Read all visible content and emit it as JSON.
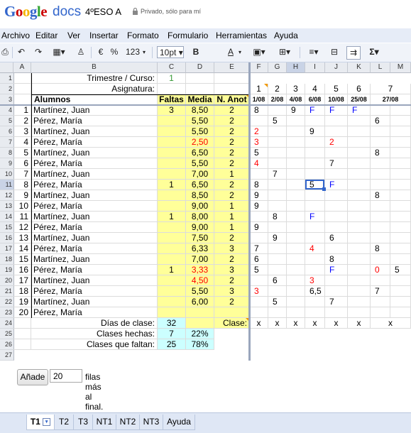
{
  "header": {
    "logo_text": "Google",
    "product": "docs",
    "doc_title": "4ºESO A",
    "privacy": "Privado, sólo para mí"
  },
  "menu": [
    "Archivo",
    "Editar",
    "Ver",
    "Insertar",
    "Formato",
    "Formulario",
    "Herramientas",
    "Ayuda"
  ],
  "toolbar": {
    "items": [
      "print-icon",
      "undo-icon",
      "redo-icon",
      "paint-format-icon",
      "clear-format-icon"
    ],
    "currency": "€",
    "percent": "%",
    "number_format": "123",
    "font_size": "10pt",
    "bold": "B",
    "text_color": "A",
    "sum": "Σ"
  },
  "columns": [
    "A",
    "B",
    "C",
    "D",
    "E",
    "F",
    "G",
    "H",
    "I",
    "J",
    "K",
    "L",
    "M"
  ],
  "selected_col": "H",
  "selected_row": 11,
  "sheet": {
    "r1": {
      "label": "Trimestre / Curso:",
      "value": "1"
    },
    "r2": {
      "label": "Asignatura:",
      "days": [
        "1",
        "2",
        "3",
        "4",
        "5",
        "6",
        "7"
      ]
    },
    "r3": {
      "alumnos": "Alumnos",
      "faltas": "Faltas",
      "media": "Media",
      "nanot": "N. Anot",
      "dates": [
        "1/08",
        "2/08",
        "4/08",
        "6/08",
        "10/08",
        "25/08",
        "27/08"
      ]
    },
    "students": [
      {
        "n": "1",
        "name": "Martínez, Juan",
        "faltas": "3",
        "media": "8,50",
        "anot": "2",
        "g": [
          "8",
          "",
          "9",
          "F",
          "F",
          "F",
          "",
          ""
        ]
      },
      {
        "n": "2",
        "name": "Pérez, María",
        "faltas": "",
        "media": "5,50",
        "anot": "2",
        "g": [
          "",
          "5",
          "",
          "",
          "",
          "",
          "6",
          ""
        ]
      },
      {
        "n": "3",
        "name": "Martínez, Juan",
        "faltas": "",
        "media": "5,50",
        "anot": "2",
        "g": [
          "2",
          "",
          "",
          "9",
          "",
          "",
          "",
          ""
        ]
      },
      {
        "n": "4",
        "name": "Pérez, María",
        "faltas": "",
        "media": "2,50",
        "anot": "2",
        "g": [
          "3",
          "",
          "",
          "",
          "2",
          "",
          "",
          ""
        ]
      },
      {
        "n": "5",
        "name": "Martínez, Juan",
        "faltas": "",
        "media": "6,50",
        "anot": "2",
        "g": [
          "5",
          "",
          "",
          "",
          "",
          "",
          "8",
          ""
        ]
      },
      {
        "n": "6",
        "name": "Pérez, María",
        "faltas": "",
        "media": "5,50",
        "anot": "2",
        "g": [
          "4",
          "",
          "",
          "",
          "7",
          "",
          "",
          ""
        ]
      },
      {
        "n": "7",
        "name": "Martínez, Juan",
        "faltas": "",
        "media": "7,00",
        "anot": "1",
        "g": [
          "",
          "7",
          "",
          "",
          "",
          "",
          "",
          ""
        ]
      },
      {
        "n": "8",
        "name": "Pérez, María",
        "faltas": "1",
        "media": "6,50",
        "anot": "2",
        "g": [
          "8",
          "",
          "",
          "5",
          "F",
          "",
          "",
          ""
        ]
      },
      {
        "n": "9",
        "name": "Martínez, Juan",
        "faltas": "",
        "media": "8,50",
        "anot": "2",
        "g": [
          "9",
          "",
          "",
          "",
          "",
          "",
          "8",
          ""
        ]
      },
      {
        "n": "10",
        "name": "Pérez, María",
        "faltas": "",
        "media": "9,00",
        "anot": "1",
        "g": [
          "9",
          "",
          "",
          "",
          "",
          "",
          "",
          ""
        ]
      },
      {
        "n": "11",
        "name": "Martínez, Juan",
        "faltas": "1",
        "media": "8,00",
        "anot": "1",
        "g": [
          "",
          "8",
          "",
          "F",
          "",
          "",
          "",
          ""
        ]
      },
      {
        "n": "12",
        "name": "Pérez, María",
        "faltas": "",
        "media": "9,00",
        "anot": "1",
        "g": [
          "9",
          "",
          "",
          "",
          "",
          "",
          "",
          ""
        ]
      },
      {
        "n": "13",
        "name": "Martínez, Juan",
        "faltas": "",
        "media": "7,50",
        "anot": "2",
        "g": [
          "",
          "9",
          "",
          "",
          "6",
          "",
          "",
          ""
        ]
      },
      {
        "n": "14",
        "name": "Pérez, María",
        "faltas": "",
        "media": "6,33",
        "anot": "3",
        "g": [
          "7",
          "",
          "",
          "4",
          "",
          "",
          "8",
          ""
        ]
      },
      {
        "n": "15",
        "name": "Martínez, Juan",
        "faltas": "",
        "media": "7,00",
        "anot": "2",
        "g": [
          "6",
          "",
          "",
          "",
          "8",
          "",
          "",
          ""
        ]
      },
      {
        "n": "16",
        "name": "Pérez, María",
        "faltas": "1",
        "media": "3,33",
        "anot": "3",
        "g": [
          "5",
          "",
          "",
          "",
          "F",
          "",
          "0",
          "5"
        ]
      },
      {
        "n": "17",
        "name": "Martínez, Juan",
        "faltas": "",
        "media": "4,50",
        "anot": "2",
        "g": [
          "",
          "6",
          "",
          "3",
          "",
          "",
          "",
          ""
        ]
      },
      {
        "n": "18",
        "name": "Pérez, María",
        "faltas": "",
        "media": "5,50",
        "anot": "3",
        "g": [
          "3",
          "",
          "",
          "6,5",
          "",
          "",
          "7",
          ""
        ]
      },
      {
        "n": "19",
        "name": "Martínez, Juan",
        "faltas": "",
        "media": "6,00",
        "anot": "2",
        "g": [
          "",
          "5",
          "",
          "",
          "7",
          "",
          "",
          ""
        ]
      },
      {
        "n": "20",
        "name": "Pérez, María",
        "faltas": "",
        "media": "",
        "anot": "",
        "g": [
          "",
          "",
          "",
          "",
          "",
          "",
          "",
          ""
        ]
      }
    ],
    "summary": {
      "dias_label": "Días de clase:",
      "dias_value": "32",
      "clase_label": "Clase:",
      "clase_marks": [
        "x",
        "x",
        "x",
        "x",
        "x",
        "x",
        "x"
      ],
      "hechas_label": "Clases hechas:",
      "hechas_value": "7",
      "hechas_pct": "22%",
      "faltan_label": "Clases que faltan:",
      "faltan_value": "25",
      "faltan_pct": "78%"
    }
  },
  "add_rows": {
    "button": "Añade",
    "value": "20",
    "text": "filas más al final."
  },
  "tabs": [
    "T1",
    "T2",
    "T3",
    "NT1",
    "NT2",
    "NT3",
    "Ayuda"
  ],
  "active_tab": "T1",
  "colors": {
    "accent_blue": "#3366cc",
    "yellow": "#ffff99",
    "cyan": "#ccffff",
    "red": "#ff0000",
    "blue_text": "#0000ff"
  }
}
